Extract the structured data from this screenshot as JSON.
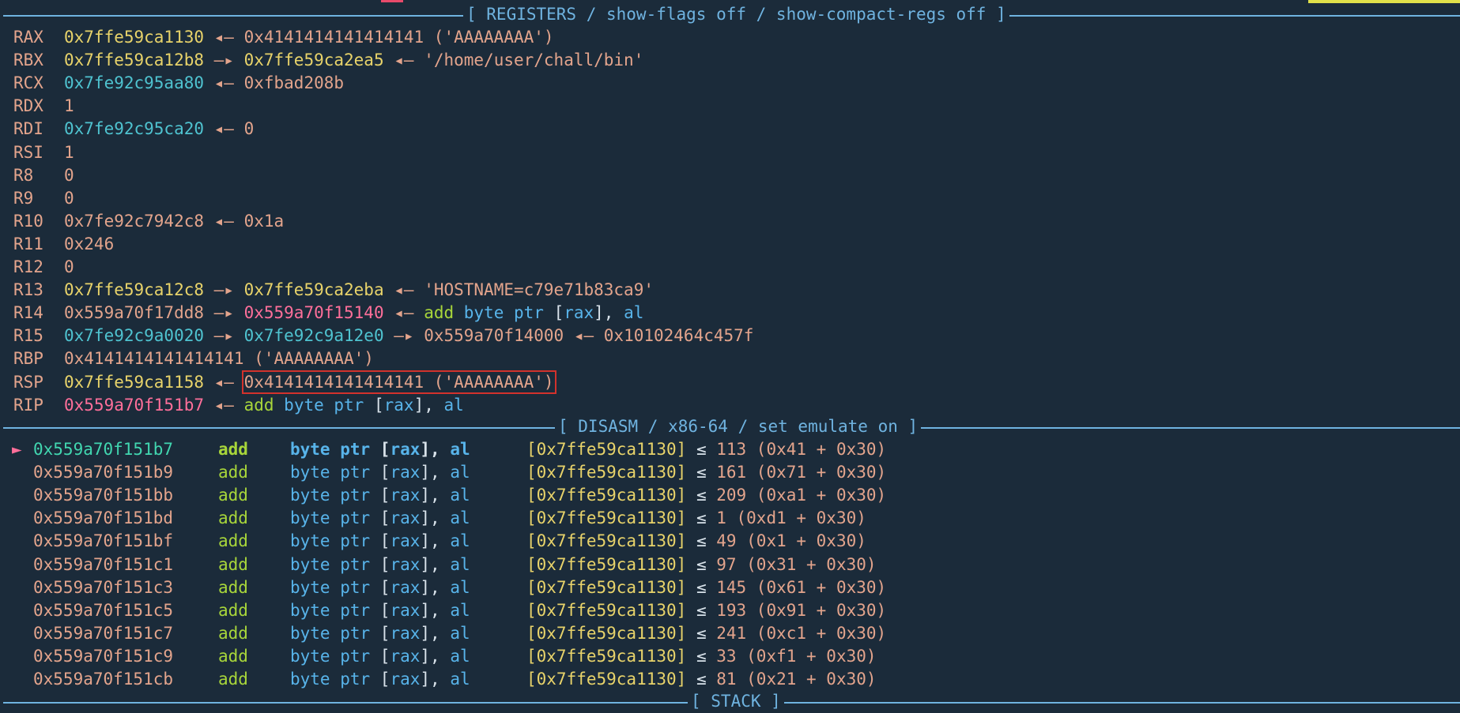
{
  "registers_panel": {
    "title": "[ REGISTERS / show-flags off / show-compact-regs off ]",
    "rows": [
      {
        "name": "RAX",
        "segs": [
          {
            "t": "0x7ffe59ca1130",
            "c": "yellow"
          },
          {
            "t": " ◂— ",
            "c": "arrow"
          },
          {
            "t": "0x4141414141414141 ('AAAAAAAA')",
            "c": "salmon"
          }
        ]
      },
      {
        "name": "RBX",
        "segs": [
          {
            "t": "0x7ffe59ca12b8",
            "c": "yellow"
          },
          {
            "t": " —▸ ",
            "c": "arrow"
          },
          {
            "t": "0x7ffe59ca2ea5",
            "c": "yellow"
          },
          {
            "t": " ◂— ",
            "c": "arrow"
          },
          {
            "t": "'/home/user/chall/bin'",
            "c": "salmon"
          }
        ]
      },
      {
        "name": "RCX",
        "segs": [
          {
            "t": "0x7fe92c95aa80",
            "c": "cyan"
          },
          {
            "t": " ◂— ",
            "c": "arrow"
          },
          {
            "t": "0xfbad208b",
            "c": "salmon"
          }
        ]
      },
      {
        "name": "RDX",
        "segs": [
          {
            "t": "1",
            "c": "salmon"
          }
        ]
      },
      {
        "name": "RDI",
        "segs": [
          {
            "t": "0x7fe92c95ca20",
            "c": "cyan"
          },
          {
            "t": " ◂— ",
            "c": "arrow"
          },
          {
            "t": "0",
            "c": "salmon"
          }
        ]
      },
      {
        "name": "RSI",
        "segs": [
          {
            "t": "1",
            "c": "salmon"
          }
        ]
      },
      {
        "name": "R8",
        "segs": [
          {
            "t": "0",
            "c": "salmon"
          }
        ]
      },
      {
        "name": "R9",
        "segs": [
          {
            "t": "0",
            "c": "salmon"
          }
        ]
      },
      {
        "name": "R10",
        "segs": [
          {
            "t": "0x7fe92c7942c8",
            "c": "salmon"
          },
          {
            "t": " ◂— ",
            "c": "arrow"
          },
          {
            "t": "0x1a",
            "c": "salmon"
          }
        ]
      },
      {
        "name": "R11",
        "segs": [
          {
            "t": "0x246",
            "c": "salmon"
          }
        ]
      },
      {
        "name": "R12",
        "segs": [
          {
            "t": "0",
            "c": "salmon"
          }
        ]
      },
      {
        "name": "R13",
        "segs": [
          {
            "t": "0x7ffe59ca12c8",
            "c": "yellow"
          },
          {
            "t": " —▸ ",
            "c": "arrow"
          },
          {
            "t": "0x7ffe59ca2eba",
            "c": "yellow"
          },
          {
            "t": " ◂— ",
            "c": "arrow"
          },
          {
            "t": "'HOSTNAME=c79e71b83ca9'",
            "c": "salmon"
          }
        ]
      },
      {
        "name": "R14",
        "segs": [
          {
            "t": "0x559a70f17dd8",
            "c": "salmon"
          },
          {
            "t": " —▸ ",
            "c": "arrow"
          },
          {
            "t": "0x559a70f15140",
            "c": "pink"
          },
          {
            "t": " ◂— ",
            "c": "arrow"
          },
          {
            "t": "add",
            "c": "green"
          },
          {
            "t": " byte ptr ",
            "c": "blue"
          },
          {
            "t": "[",
            "c": "white"
          },
          {
            "t": "rax",
            "c": "blue"
          },
          {
            "t": "], ",
            "c": "white"
          },
          {
            "t": "al",
            "c": "blue"
          }
        ]
      },
      {
        "name": "R15",
        "segs": [
          {
            "t": "0x7fe92c9a0020",
            "c": "cyan"
          },
          {
            "t": " —▸ ",
            "c": "arrow"
          },
          {
            "t": "0x7fe92c9a12e0",
            "c": "cyan"
          },
          {
            "t": " —▸ ",
            "c": "arrow"
          },
          {
            "t": "0x559a70f14000",
            "c": "salmon"
          },
          {
            "t": " ◂— ",
            "c": "arrow"
          },
          {
            "t": "0x10102464c457f",
            "c": "salmon"
          }
        ]
      },
      {
        "name": "RBP",
        "segs": [
          {
            "t": "0x4141414141414141 ('AAAAAAAA')",
            "c": "salmon"
          }
        ]
      },
      {
        "name": "RSP",
        "segs": [
          {
            "t": "0x7ffe59ca1158",
            "c": "yellow"
          },
          {
            "t": " ◂— ",
            "c": "arrow"
          },
          {
            "t": "0x4141414141414141 ('AAAAAAAA')",
            "c": "salmon",
            "hl": true
          }
        ]
      },
      {
        "name": "RIP",
        "segs": [
          {
            "t": "0x559a70f151b7",
            "c": "pink"
          },
          {
            "t": " ◂— ",
            "c": "arrow"
          },
          {
            "t": "add",
            "c": "green"
          },
          {
            "t": " byte ptr ",
            "c": "blue"
          },
          {
            "t": "[",
            "c": "white"
          },
          {
            "t": "rax",
            "c": "blue"
          },
          {
            "t": "], ",
            "c": "white"
          },
          {
            "t": "al",
            "c": "blue"
          }
        ]
      }
    ]
  },
  "disasm_panel": {
    "title": "[ DISASM / x86-64 / set emulate on ]",
    "current_marker": "►",
    "rows": [
      {
        "addr": "0x559a70f151b7",
        "mn": "add",
        "target": "[0x7ffe59ca1130]",
        "sym": "≤",
        "result": "113 (0x41 + 0x30)",
        "current": true
      },
      {
        "addr": "0x559a70f151b9",
        "mn": "add",
        "target": "[0x7ffe59ca1130]",
        "sym": "≤",
        "result": "161 (0x71 + 0x30)"
      },
      {
        "addr": "0x559a70f151bb",
        "mn": "add",
        "target": "[0x7ffe59ca1130]",
        "sym": "≤",
        "result": "209 (0xa1 + 0x30)"
      },
      {
        "addr": "0x559a70f151bd",
        "mn": "add",
        "target": "[0x7ffe59ca1130]",
        "sym": "≤",
        "result": "1 (0xd1 + 0x30)"
      },
      {
        "addr": "0x559a70f151bf",
        "mn": "add",
        "target": "[0x7ffe59ca1130]",
        "sym": "≤",
        "result": "49 (0x1 + 0x30)"
      },
      {
        "addr": "0x559a70f151c1",
        "mn": "add",
        "target": "[0x7ffe59ca1130]",
        "sym": "≤",
        "result": "97 (0x31 + 0x30)"
      },
      {
        "addr": "0x559a70f151c3",
        "mn": "add",
        "target": "[0x7ffe59ca1130]",
        "sym": "≤",
        "result": "145 (0x61 + 0x30)"
      },
      {
        "addr": "0x559a70f151c5",
        "mn": "add",
        "target": "[0x7ffe59ca1130]",
        "sym": "≤",
        "result": "193 (0x91 + 0x30)"
      },
      {
        "addr": "0x559a70f151c7",
        "mn": "add",
        "target": "[0x7ffe59ca1130]",
        "sym": "≤",
        "result": "241 (0xc1 + 0x30)"
      },
      {
        "addr": "0x559a70f151c9",
        "mn": "add",
        "target": "[0x7ffe59ca1130]",
        "sym": "≤",
        "result": "33 (0xf1 + 0x30)"
      },
      {
        "addr": "0x559a70f151cb",
        "mn": "add",
        "target": "[0x7ffe59ca1130]",
        "sym": "≤",
        "result": "81 (0x21 + 0x30)"
      }
    ],
    "operand": {
      "pre": "byte ptr ",
      "lb": "[",
      "reg": "rax",
      "rb": "], ",
      "src": "al"
    }
  },
  "stack_panel": {
    "title": "[ STACK ]"
  },
  "colors": {
    "background": "#1b2b3a",
    "separator": "#6fb3e0",
    "pointer_stack": "#e8d36a",
    "pointer_code": "#ff6f9a",
    "pointer_lib": "#4fc3d0",
    "value": "#e3a48c",
    "mnemonic": "#a8d63a",
    "operand": "#58b4ea",
    "highlight_box": "#d2322c"
  }
}
